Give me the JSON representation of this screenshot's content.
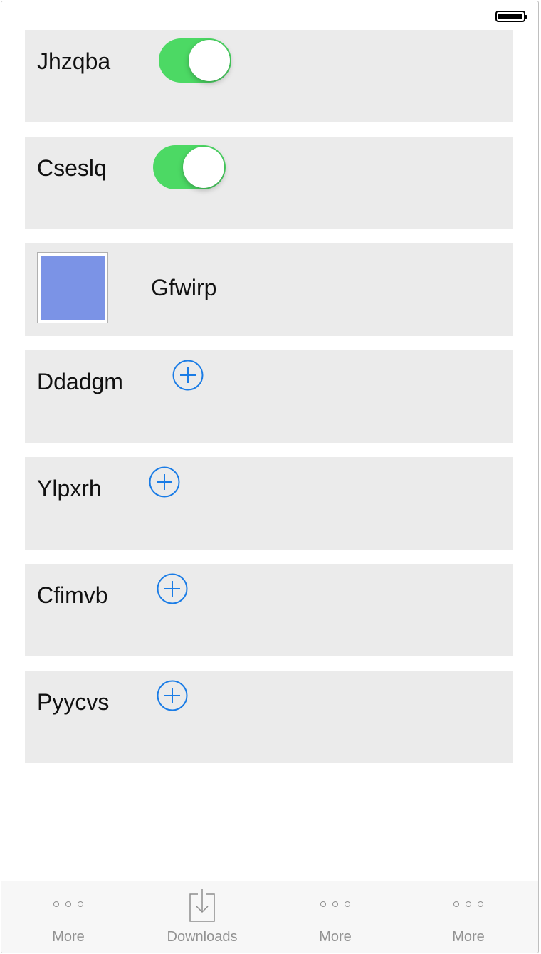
{
  "status_bar": {
    "battery_icon": "battery-full-icon"
  },
  "list": {
    "items": [
      {
        "type": "toggle",
        "label": "Jhzqba",
        "toggle_on": true
      },
      {
        "type": "toggle",
        "label": "Cseslq",
        "toggle_on": true
      },
      {
        "type": "image",
        "label": "Gfwirp",
        "swatch_color": "#7b93e6"
      },
      {
        "type": "add",
        "label": "Ddadgm",
        "icon": "plus-circle-icon"
      },
      {
        "type": "add",
        "label": "Ylpxrh",
        "icon": "plus-circle-icon"
      },
      {
        "type": "add",
        "label": "Cfimvb",
        "icon": "plus-circle-icon"
      },
      {
        "type": "add",
        "label": "Pyycvs",
        "icon": "plus-circle-icon"
      }
    ]
  },
  "tab_bar": {
    "tabs": [
      {
        "label": "More",
        "icon": "more-dots-icon"
      },
      {
        "label": "Downloads",
        "icon": "download-tray-icon"
      },
      {
        "label": "More",
        "icon": "more-dots-icon"
      },
      {
        "label": "More",
        "icon": "more-dots-icon"
      }
    ]
  },
  "colors": {
    "toggle_on": "#4cd964",
    "accent_blue": "#1a7ce6",
    "cell_background": "#ebebeb",
    "tab_label": "#929292"
  }
}
